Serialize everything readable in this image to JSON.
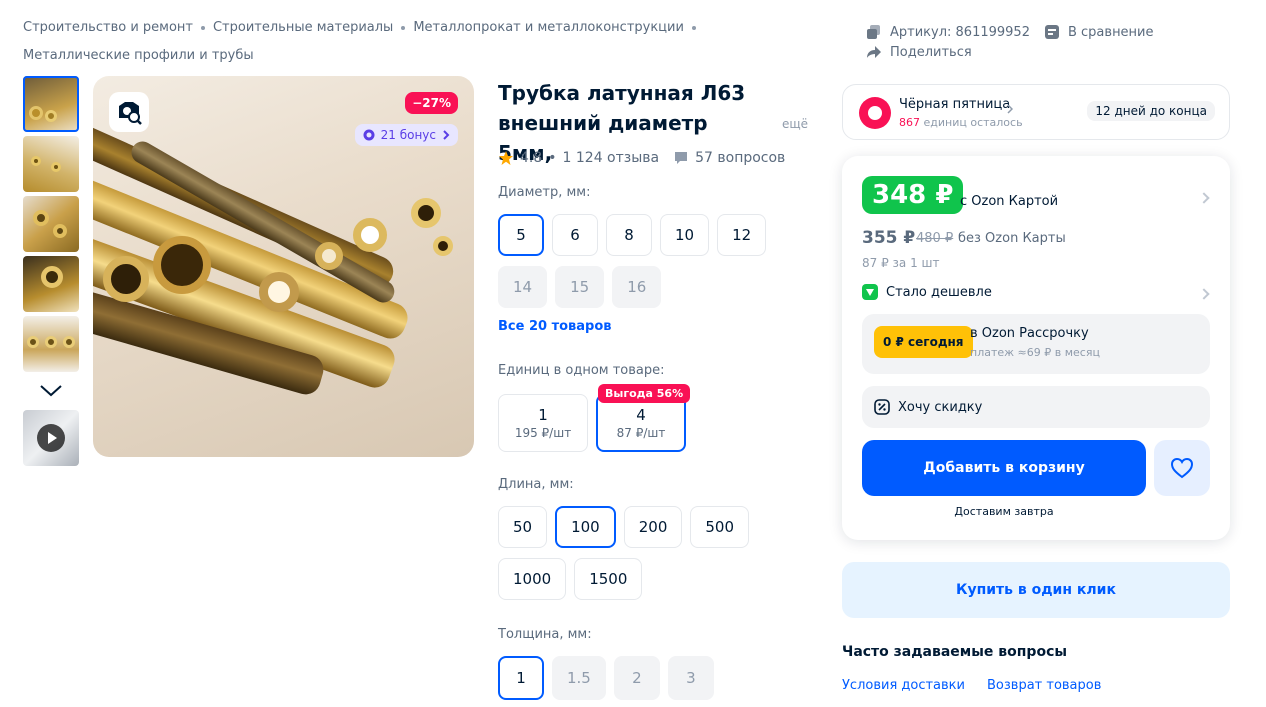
{
  "breadcrumbs": [
    "Строительство и ремонт",
    "Строительные материалы",
    "Металлопрокат и металлоконструкции",
    "Металлические профили и трубы"
  ],
  "image": {
    "discount": "−27%",
    "bonus": "21 бонус"
  },
  "product": {
    "title_line1": "Трубка латунная Л63",
    "title_line2": "внешний диаметр 5мм,",
    "more": "ещё",
    "rating": "4.8",
    "reviews": "1 124 отзыва",
    "questions": "57 вопросов"
  },
  "options": {
    "diameter_label": "Диаметр, мм:",
    "diameters": [
      "5",
      "6",
      "8",
      "10",
      "12",
      "14",
      "15",
      "16"
    ],
    "all_items": "Все 20 товаров",
    "units_label": "Единиц в одном товаре:",
    "units": [
      {
        "count": "1",
        "price": "195 ₽/шт"
      },
      {
        "count": "4",
        "price": "87 ₽/шт"
      }
    ],
    "vygoda": "Выгода 56%",
    "length_label": "Длина, мм:",
    "lengths": [
      "50",
      "100",
      "200",
      "500",
      "1000",
      "1500"
    ],
    "thickness_label": "Толщина, мм:",
    "thicknesses": [
      "1",
      "1.5",
      "2",
      "3"
    ]
  },
  "meta": {
    "article": "Артикул: 861199952",
    "compare": "В сравнение",
    "share": "Поделиться"
  },
  "promo": {
    "title": "Чёрная пятница",
    "left_count": "867",
    "left_text": "единиц осталось",
    "days": "12 дней до конца"
  },
  "price": {
    "ozon": "348 ₽",
    "ozon_label": "с Ozon Картой",
    "regular": "355 ₽",
    "old": "480 ₽",
    "no_card": "без Ozon Карты",
    "per_unit": "87 ₽ за 1 шт",
    "cheaper": "Стало дешевле"
  },
  "installment": {
    "badge": "0 ₽ сегодня",
    "title": "в Ozon Рассрочку",
    "sub": "платеж ≈69 ₽ в месяц"
  },
  "actions": {
    "want_discount": "Хочу скидку",
    "add_to_cart": "Добавить в корзину",
    "delivery": "Доставим завтра",
    "buy_one_click": "Купить в один клик"
  },
  "faq": {
    "title": "Часто задаваемые вопросы",
    "links": [
      "Условия доставки",
      "Возврат товаров"
    ]
  },
  "colors": {
    "accent": "#005bff",
    "sale": "#f91155",
    "ozon_green": "#10c44c"
  }
}
